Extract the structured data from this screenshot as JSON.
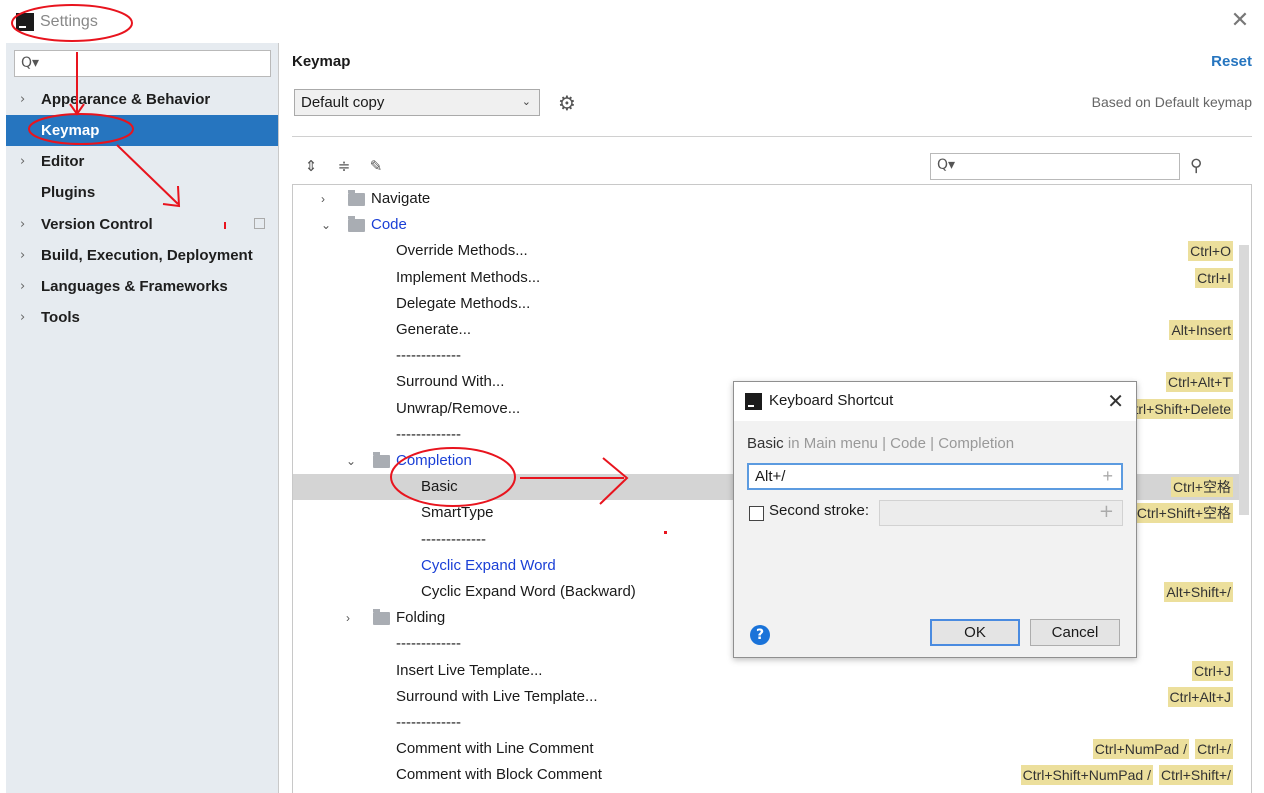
{
  "window": {
    "title": "Settings",
    "close_glyph": "✕"
  },
  "sidebar": {
    "search_glyph": "Q▾",
    "items": [
      {
        "label": "Appearance & Behavior",
        "chevron": "›"
      },
      {
        "label": "Keymap",
        "chevron": ""
      },
      {
        "label": "Editor",
        "chevron": "›"
      },
      {
        "label": "Plugins",
        "chevron": ""
      },
      {
        "label": "Version Control",
        "chevron": "›"
      },
      {
        "label": "Build, Execution, Deployment",
        "chevron": "›"
      },
      {
        "label": "Languages & Frameworks",
        "chevron": "›"
      },
      {
        "label": "Tools",
        "chevron": "›"
      }
    ]
  },
  "main": {
    "title": "Keymap",
    "reset_label": "Reset",
    "keymap_value": "Default copy",
    "select_arrow": "⌄",
    "gear_glyph": "⚙",
    "based_on": "Based on Default keymap",
    "toolbar": {
      "expand_glyph": "⇕",
      "collapse_glyph": "≑",
      "edit_glyph": "✎",
      "search_glyph": "Q▾",
      "find_glyph": "⚲"
    }
  },
  "tree": {
    "rows": [
      {
        "text": "Navigate",
        "chevron": "›",
        "folder": true,
        "indent": 0,
        "shortcuts": []
      },
      {
        "text": "Code",
        "chevron": "⌄",
        "folder": true,
        "indent": 0,
        "blue": true,
        "shortcuts": []
      },
      {
        "text": "Override Methods...",
        "indent": 2,
        "shortcuts": [
          "Ctrl+O"
        ]
      },
      {
        "text": "Implement Methods...",
        "indent": 2,
        "shortcuts": [
          "Ctrl+I"
        ]
      },
      {
        "text": "Delegate Methods...",
        "indent": 2,
        "shortcuts": []
      },
      {
        "text": "Generate...",
        "indent": 2,
        "shortcuts": [
          "Alt+Insert"
        ]
      },
      {
        "text": "-------------",
        "indent": 2,
        "shortcuts": []
      },
      {
        "text": "Surround With...",
        "indent": 2,
        "shortcuts": [
          "Ctrl+Alt+T"
        ]
      },
      {
        "text": "Unwrap/Remove...",
        "indent": 2,
        "shortcuts": [
          "Ctrl+Shift+Delete"
        ]
      },
      {
        "text": "-------------",
        "indent": 2,
        "shortcuts": []
      },
      {
        "text": "Completion",
        "chevron": "⌄",
        "folder": true,
        "indent": 1,
        "blue": true,
        "shortcuts": []
      },
      {
        "text": "Basic",
        "indent": 3,
        "selected": true,
        "shortcuts": [
          "Ctrl+空格"
        ]
      },
      {
        "text": "SmartType",
        "indent": 3,
        "shortcuts": [
          "Ctrl+Shift+空格"
        ]
      },
      {
        "text": "-------------",
        "indent": 3,
        "shortcuts": []
      },
      {
        "text": "Cyclic Expand Word",
        "indent": 3,
        "blue": true,
        "shortcuts": []
      },
      {
        "text": "Cyclic Expand Word (Backward)",
        "indent": 3,
        "shortcuts": [
          "Alt+Shift+/"
        ]
      },
      {
        "text": "Folding",
        "chevron": "›",
        "folder": true,
        "indent": 1,
        "shortcuts": []
      },
      {
        "text": "-------------",
        "indent": 2,
        "shortcuts": []
      },
      {
        "text": "Insert Live Template...",
        "indent": 2,
        "shortcuts": [
          "Ctrl+J"
        ]
      },
      {
        "text": "Surround with Live Template...",
        "indent": 2,
        "shortcuts": [
          "Ctrl+Alt+J"
        ]
      },
      {
        "text": "-------------",
        "indent": 2,
        "shortcuts": []
      },
      {
        "text": "Comment with Line Comment",
        "indent": 2,
        "shortcuts": [
          "Ctrl+/",
          "Ctrl+NumPad /"
        ]
      },
      {
        "text": "Comment with Block Comment",
        "indent": 2,
        "shortcuts": [
          "Ctrl+Shift+/",
          "Ctrl+Shift+NumPad /"
        ]
      }
    ]
  },
  "dialog": {
    "title": "Keyboard Shortcut",
    "close_glyph": "✕",
    "action_name": "Basic",
    "action_path": " in Main menu | Code | Completion",
    "first_stroke": "Alt+/",
    "plus_glyph": "+",
    "second_stroke_label": "Second stroke:",
    "help_glyph": "?",
    "ok_label": "OK",
    "cancel_label": "Cancel"
  },
  "colors": {
    "selection": "#2675bf",
    "shortcut_badge": "#ecdf9c",
    "annotation": "#e8141e"
  }
}
